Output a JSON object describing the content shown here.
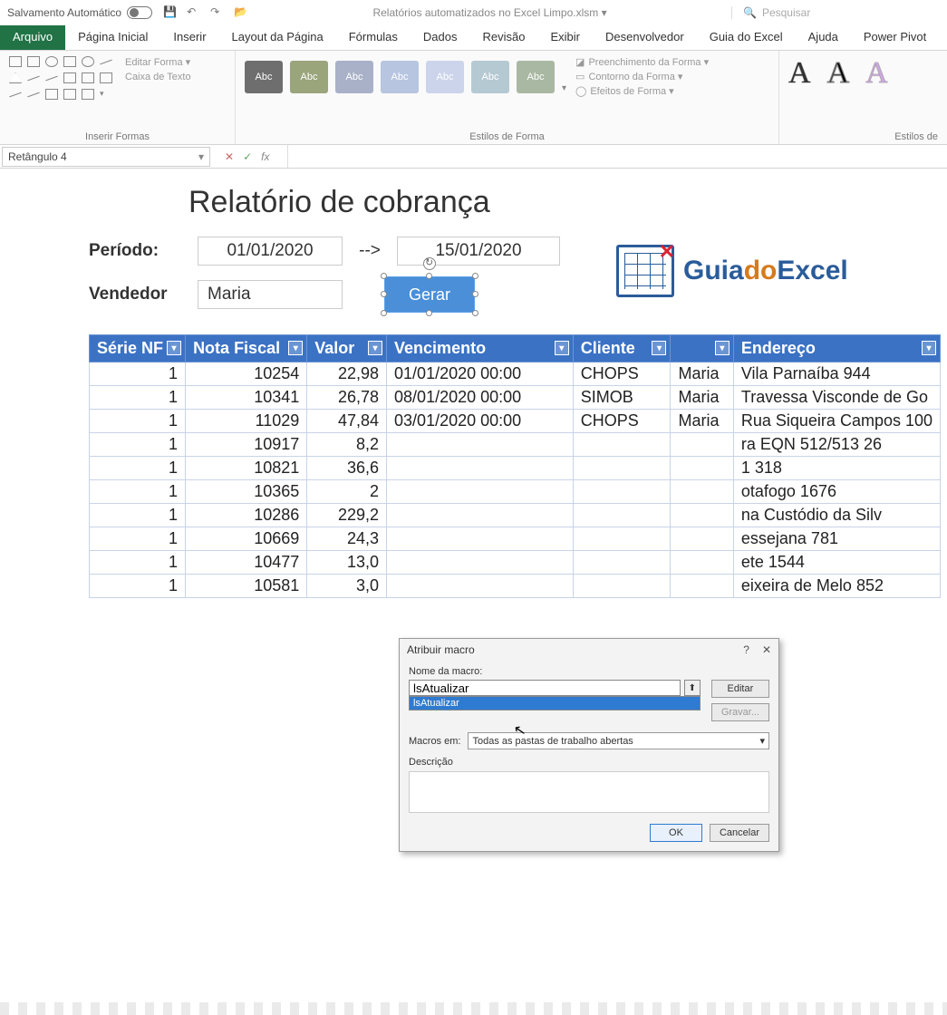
{
  "titlebar": {
    "autosave": "Salvamento Automático",
    "doc_title": "Relatórios automatizados no Excel Limpo.xlsm ▾",
    "search_placeholder": "Pesquisar"
  },
  "tabs": [
    "Arquivo",
    "Página Inicial",
    "Inserir",
    "Layout da Página",
    "Fórmulas",
    "Dados",
    "Revisão",
    "Exibir",
    "Desenvolvedor",
    "Guia do Excel",
    "Ajuda",
    "Power Pivot"
  ],
  "ribbon": {
    "group_insert_shapes": "Inserir Formas",
    "edit_shape": "Editar Forma ▾",
    "text_box": "Caixa de Texto",
    "group_shape_styles": "Estilos de Forma",
    "style_tile_label": "Abc",
    "fill": "Preenchimento da Forma ▾",
    "outline": "Contorno da Forma ▾",
    "effects": "Efeitos de Forma ▾",
    "group_wordart": "Estilos de"
  },
  "formula_bar": {
    "name_box": "Retângulo 4",
    "fx": "fx"
  },
  "report": {
    "title": "Relatório de cobrança",
    "period_label": "Período:",
    "date_from": "01/01/2020",
    "arrow": "-->",
    "date_to": "15/01/2020",
    "vendor_label": "Vendedor",
    "vendor_value": "Maria",
    "generate": "Gerar",
    "logo_guia": "Guia",
    "logo_do": "do",
    "logo_excel": "Excel"
  },
  "table": {
    "headers": [
      "Série NF",
      "Nota Fiscal",
      "Valor",
      "Vencimento",
      "Cliente",
      "",
      "Endereço"
    ],
    "rows": [
      {
        "serie": "1",
        "nf": "10254",
        "valor": "22,98",
        "venc": "01/01/2020 00:00",
        "cliente": "CHOPS",
        "vend": "Maria",
        "end": "Vila Parnaíba 944"
      },
      {
        "serie": "1",
        "nf": "10341",
        "valor": "26,78",
        "venc": "08/01/2020 00:00",
        "cliente": "SIMOB",
        "vend": "Maria",
        "end": "Travessa Visconde de Go"
      },
      {
        "serie": "1",
        "nf": "11029",
        "valor": "47,84",
        "venc": "03/01/2020 00:00",
        "cliente": "CHOPS",
        "vend": "Maria",
        "end": "Rua Siqueira Campos 100"
      },
      {
        "serie": "1",
        "nf": "10917",
        "valor": "8,2",
        "venc": "",
        "cliente": "",
        "vend": "",
        "end": "ra EQN 512/513 26"
      },
      {
        "serie": "1",
        "nf": "10821",
        "valor": "36,6",
        "venc": "",
        "cliente": "",
        "vend": "",
        "end": "1 318"
      },
      {
        "serie": "1",
        "nf": "10365",
        "valor": "2",
        "venc": "",
        "cliente": "",
        "vend": "",
        "end": "otafogo 1676"
      },
      {
        "serie": "1",
        "nf": "10286",
        "valor": "229,2",
        "venc": "",
        "cliente": "",
        "vend": "",
        "end": "na Custódio da Silv"
      },
      {
        "serie": "1",
        "nf": "10669",
        "valor": "24,3",
        "venc": "",
        "cliente": "",
        "vend": "",
        "end": "essejana 781"
      },
      {
        "serie": "1",
        "nf": "10477",
        "valor": "13,0",
        "venc": "",
        "cliente": "",
        "vend": "",
        "end": "ete 1544"
      },
      {
        "serie": "1",
        "nf": "10581",
        "valor": "3,0",
        "venc": "",
        "cliente": "",
        "vend": "",
        "end": "eixeira de Melo 852"
      }
    ]
  },
  "dialog": {
    "title": "Atribuir macro",
    "name_label": "Nome da macro:",
    "macro_name": "lsAtualizar",
    "list_item": "lsAtualizar",
    "edit": "Editar",
    "record": "Gravar...",
    "macros_in_label": "Macros em:",
    "macros_in_value": "Todas as pastas de trabalho abertas",
    "desc_label": "Descrição",
    "ok": "OK",
    "cancel": "Cancelar"
  }
}
